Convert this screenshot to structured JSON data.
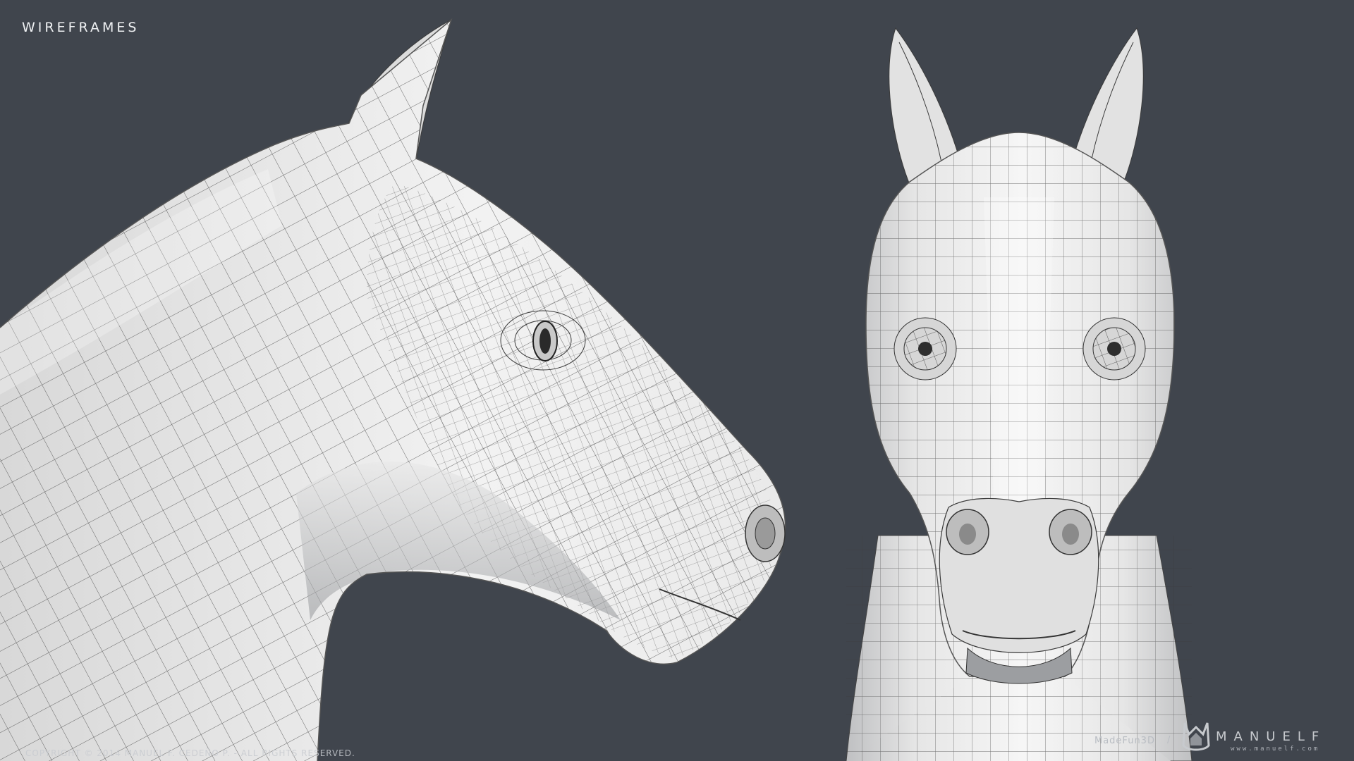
{
  "header": {
    "title": "WIREFRAMES"
  },
  "footer": {
    "copyright": "COPYRIGHT © 2014 MANUEL F. CEDEÑO P. - ALL RIGHTS RESERVED.",
    "credit": "MadeFun3D",
    "separator": "/",
    "brand_name": "MANUELF",
    "brand_url": "www.manuelf.com"
  },
  "views": {
    "side": {
      "subject": "horse-head-side-view"
    },
    "front": {
      "subject": "horse-head-front-view"
    }
  },
  "colors": {
    "background": "#40454d",
    "mesh_fill": "#e9e9e9",
    "mesh_shadow": "#8f9194",
    "wire": "#3a3a3a"
  }
}
